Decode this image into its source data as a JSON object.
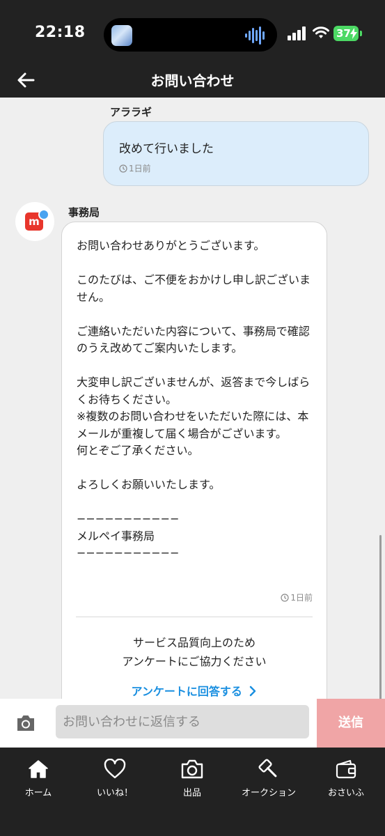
{
  "status_bar": {
    "time": "22:18",
    "battery": "37",
    "icons": [
      "island-app-icon",
      "audio-wave-icon",
      "signal-icon",
      "wifi-icon",
      "battery-icon"
    ]
  },
  "header": {
    "title": "お問い合わせ",
    "back_icon": "back-arrow-icon"
  },
  "chat": {
    "user_message": {
      "sender": "アララギ",
      "text": "改めて行いました",
      "time": "1日前"
    },
    "office_message": {
      "sender": "事務局",
      "avatar": "mercari-logo",
      "text": "お問い合わせありがとうございます。\n\nこのたびは、ご不便をおかけし申し訳ございません。\n\nご連絡いただいた内容について、事務局で確認のうえ改めてご案内いたします。\n\n大変申し訳ございませんが、返答まで今しばらくお待ちください。\n※複数のお問い合わせをいただいた際には、本メールが重複して届く場合がございます。\n何とぞご了承ください。\n\nよろしくお願いいたします。\n\n−−−−−−−−−−−\nメルペイ事務局\n−−−−−−−−−−−",
      "time": "1日前",
      "survey_line1": "サービス品質向上のため",
      "survey_line2": "アンケートにご協力ください",
      "survey_link": "アンケートに回答する"
    }
  },
  "input_bar": {
    "placeholder": "お問い合わせに返信する",
    "send_label": "送信",
    "camera_icon": "camera-icon"
  },
  "bottom_nav": {
    "items": [
      {
        "label": "ホーム",
        "icon": "home-icon"
      },
      {
        "label": "いいね！",
        "icon": "heart-icon"
      },
      {
        "label": "出品",
        "icon": "camera-icon"
      },
      {
        "label": "オークション",
        "icon": "gavel-icon"
      },
      {
        "label": "おさいふ",
        "icon": "wallet-icon"
      }
    ]
  },
  "colors": {
    "header_bg": "#222222",
    "chat_bg": "#efefef",
    "user_bubble": "#dcedfb",
    "link": "#1a8fe0",
    "send_button": "#f0a5a6",
    "brand_red": "#e8362c",
    "battery_green": "#4cd964"
  }
}
